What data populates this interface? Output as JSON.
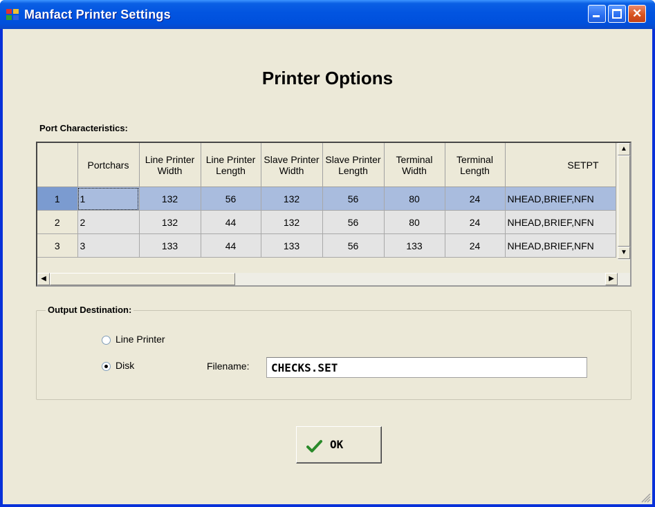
{
  "window": {
    "title": "Manfact Printer Settings",
    "minimize_glyph": "_",
    "maximize_glyph": "□",
    "close_glyph": "✕"
  },
  "heading": "Printer Options",
  "port_section": {
    "label": "Port Characteristics:",
    "columns": [
      {
        "label": "Portchars"
      },
      {
        "label": "Line Printer Width"
      },
      {
        "label": "Line Printer Length"
      },
      {
        "label": "Slave Printer Width"
      },
      {
        "label": "Slave Printer Length"
      },
      {
        "label": "Terminal Width"
      },
      {
        "label": "Terminal Length"
      },
      {
        "label": "SETPT"
      }
    ],
    "rows": [
      {
        "num": "1",
        "cells": [
          "1",
          "132",
          "56",
          "132",
          "56",
          "80",
          "24",
          "NHEAD,BRIEF,NFN"
        ]
      },
      {
        "num": "2",
        "cells": [
          "2",
          "132",
          "44",
          "132",
          "56",
          "80",
          "24",
          "NHEAD,BRIEF,NFN"
        ]
      },
      {
        "num": "3",
        "cells": [
          "3",
          "133",
          "44",
          "133",
          "56",
          "133",
          "24",
          "NHEAD,BRIEF,NFN"
        ]
      }
    ],
    "selected_row": "1",
    "scroll_glyphs": {
      "up": "▲",
      "down": "▼",
      "left": "◀",
      "right": "▶"
    }
  },
  "output_section": {
    "label": "Output Destination:",
    "options": [
      {
        "label": "Line Printer",
        "checked": false
      },
      {
        "label": "Disk",
        "checked": true
      }
    ],
    "filename_label": "Filename:",
    "filename_value": "CHECKS.SET"
  },
  "ok_button": {
    "label": "OK",
    "icon": "checkmark-icon"
  },
  "colors": {
    "title_bar": "#0054e3",
    "client_bg": "#ece9d8",
    "selected_row": "#a9bcde",
    "close_button": "#d9541f"
  }
}
